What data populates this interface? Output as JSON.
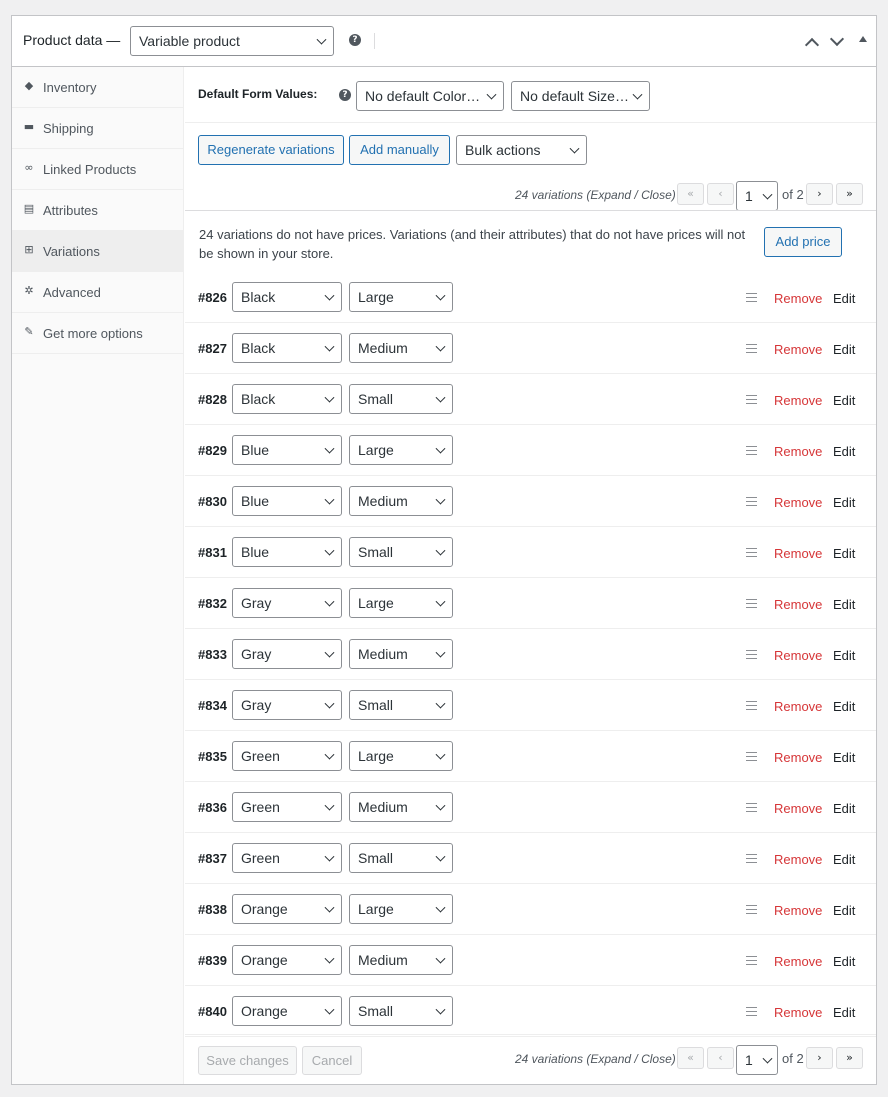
{
  "header": {
    "title": "Product data —",
    "product_type": "Variable product"
  },
  "sidebar": {
    "items": [
      {
        "label": "Inventory",
        "icon": "inventory-icon",
        "glyph": "◆"
      },
      {
        "label": "Shipping",
        "icon": "truck-icon",
        "glyph": "▬"
      },
      {
        "label": "Linked Products",
        "icon": "link-icon",
        "glyph": "∞"
      },
      {
        "label": "Attributes",
        "icon": "attributes-icon",
        "glyph": "▤"
      },
      {
        "label": "Variations",
        "icon": "grid-icon",
        "glyph": "⊞"
      },
      {
        "label": "Advanced",
        "icon": "gear-icon",
        "glyph": "✲"
      },
      {
        "label": "Get more options",
        "icon": "plug-icon",
        "glyph": "✎"
      }
    ],
    "active_index": 4
  },
  "default_form": {
    "label": "Default Form Values:",
    "color_value": "No default Color…",
    "size_value": "No default Size…"
  },
  "toolbar": {
    "regenerate_label": "Regenerate variations",
    "add_manually_label": "Add manually",
    "bulk_actions_label": "Bulk actions"
  },
  "pagination": {
    "info": "24 variations (Expand / Close)",
    "first": "«",
    "prev": "‹",
    "next": "›",
    "last": "»",
    "current_page": "1",
    "of_total": "of 2"
  },
  "notice": {
    "text": "24 variations do not have prices. Variations (and their attributes) that do not have prices will not be shown in your store.",
    "add_price_label": "Add price"
  },
  "variation_actions": {
    "remove_label": "Remove",
    "edit_label": "Edit"
  },
  "variations": [
    {
      "id": "#826",
      "color": "Black",
      "size": "Large"
    },
    {
      "id": "#827",
      "color": "Black",
      "size": "Medium"
    },
    {
      "id": "#828",
      "color": "Black",
      "size": "Small"
    },
    {
      "id": "#829",
      "color": "Blue",
      "size": "Large"
    },
    {
      "id": "#830",
      "color": "Blue",
      "size": "Medium"
    },
    {
      "id": "#831",
      "color": "Blue",
      "size": "Small"
    },
    {
      "id": "#832",
      "color": "Gray",
      "size": "Large"
    },
    {
      "id": "#833",
      "color": "Gray",
      "size": "Medium"
    },
    {
      "id": "#834",
      "color": "Gray",
      "size": "Small"
    },
    {
      "id": "#835",
      "color": "Green",
      "size": "Large"
    },
    {
      "id": "#836",
      "color": "Green",
      "size": "Medium"
    },
    {
      "id": "#837",
      "color": "Green",
      "size": "Small"
    },
    {
      "id": "#838",
      "color": "Orange",
      "size": "Large"
    },
    {
      "id": "#839",
      "color": "Orange",
      "size": "Medium"
    },
    {
      "id": "#840",
      "color": "Orange",
      "size": "Small"
    }
  ],
  "footer": {
    "save_label": "Save changes",
    "cancel_label": "Cancel"
  },
  "colors": {
    "link_blue": "#2271b1",
    "remove_red": "#d63638",
    "border": "#c3c4c7"
  }
}
